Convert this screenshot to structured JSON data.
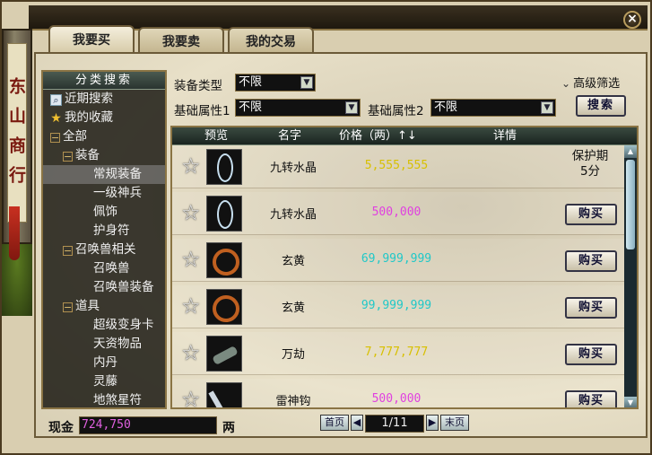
{
  "window": {
    "title_vertical": "东山商行",
    "close": "×"
  },
  "tabs": [
    {
      "label": "我要买",
      "active": true
    },
    {
      "label": "我要卖",
      "active": false
    },
    {
      "label": "我的交易",
      "active": false
    }
  ],
  "sidebar": {
    "header": "分类搜索",
    "items": [
      {
        "label": "近期搜索",
        "icon": "magnifier-icon",
        "level": 0
      },
      {
        "label": "我的收藏",
        "icon": "star-icon",
        "level": 0
      },
      {
        "label": "全部",
        "icon": "collapse-icon",
        "level": 0
      },
      {
        "label": "装备",
        "icon": "collapse-icon",
        "level": 1
      },
      {
        "label": "常规装备",
        "icon": "",
        "level": 2,
        "selected": true
      },
      {
        "label": "一级神兵",
        "icon": "",
        "level": 2
      },
      {
        "label": "佩饰",
        "icon": "",
        "level": 2
      },
      {
        "label": "护身符",
        "icon": "",
        "level": 2
      },
      {
        "label": "召唤兽相关",
        "icon": "collapse-icon",
        "level": 1
      },
      {
        "label": "召唤兽",
        "icon": "",
        "level": 2
      },
      {
        "label": "召唤兽装备",
        "icon": "",
        "level": 2
      },
      {
        "label": "道具",
        "icon": "collapse-icon",
        "level": 1
      },
      {
        "label": "超级变身卡",
        "icon": "",
        "level": 2
      },
      {
        "label": "天资物品",
        "icon": "",
        "level": 2
      },
      {
        "label": "内丹",
        "icon": "",
        "level": 2
      },
      {
        "label": "灵藤",
        "icon": "",
        "level": 2
      },
      {
        "label": "地煞星符",
        "icon": "",
        "level": 2
      }
    ]
  },
  "filters": {
    "equip_type_label": "装备类型",
    "equip_type_value": "不限",
    "attr1_label": "基础属性1",
    "attr1_value": "不限",
    "attr2_label": "基础属性2",
    "attr2_value": "不限",
    "advanced_label": "高级筛选",
    "search_label": "搜索"
  },
  "table": {
    "headers": {
      "preview": "预览",
      "name": "名字",
      "price": "价格（两）↑↓",
      "detail": "详情"
    },
    "buy_label": "购买",
    "rows": [
      {
        "name": "九转水晶",
        "price": "5,555,555",
        "price_color": "#d8c000",
        "thumb": "bead-white",
        "detail": "protect",
        "protect_line1": "保护期",
        "protect_line2": "5分"
      },
      {
        "name": "九转水晶",
        "price": "500,000",
        "price_color": "#e040e0",
        "thumb": "bead-white",
        "detail": "buy"
      },
      {
        "name": "玄黄",
        "price": "69,999,999",
        "price_color": "#20c8c8",
        "thumb": "bead-brown",
        "detail": "buy"
      },
      {
        "name": "玄黄",
        "price": "99,999,999",
        "price_color": "#20c8c8",
        "thumb": "bead-brown",
        "detail": "buy"
      },
      {
        "name": "万劫",
        "price": "7,777,777",
        "price_color": "#d8c000",
        "thumb": "blade",
        "detail": "buy"
      },
      {
        "name": "雷神钩",
        "price": "500,000",
        "price_color": "#e040e0",
        "thumb": "hook",
        "detail": "buy"
      }
    ]
  },
  "footer": {
    "cash_label": "现金",
    "cash_value": "724,750",
    "cash_unit": "两",
    "first_page": "首页",
    "last_page": "末页",
    "page_indicator": "1/11"
  }
}
